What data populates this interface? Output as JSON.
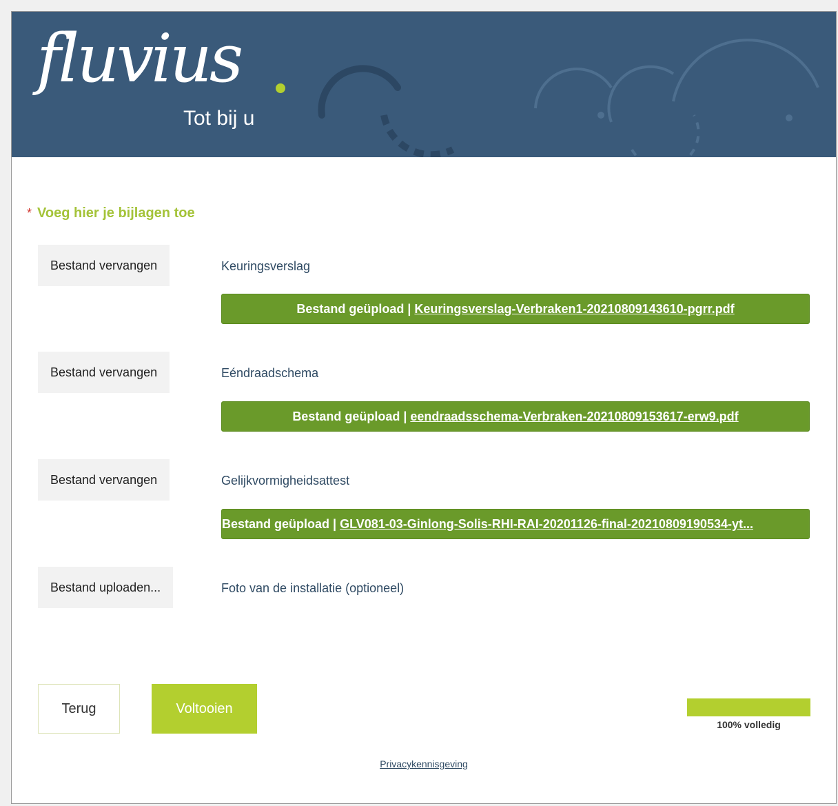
{
  "header": {
    "logo_text": "fluvius",
    "tagline": "Tot bij u"
  },
  "section": {
    "required_marker": "*",
    "title": "Voeg hier je bijlagen toe"
  },
  "attachments": [
    {
      "button_label": "Bestand vervangen",
      "label": "Keuringsverslag",
      "status_prefix": "Bestand geüpload | ",
      "file_name": "Keuringsverslag-Verbraken1-20210809143610-pgrr.pdf"
    },
    {
      "button_label": "Bestand vervangen",
      "label": "Eéndraadschema",
      "status_prefix": "Bestand geüpload | ",
      "file_name": "eendraadsschema-Verbraken-20210809153617-erw9.pdf"
    },
    {
      "button_label": "Bestand vervangen",
      "label": "Gelijkvormigheidsattest",
      "status_prefix": "Bestand geüpload | ",
      "file_name": "GLV081-03-Ginlong-Solis-RHI-RAI-20201126-final-20210809190534-yt..."
    },
    {
      "button_label": "Bestand uploaden...",
      "label": "Foto van de installatie (optioneel)"
    }
  ],
  "footer": {
    "back_label": "Terug",
    "finish_label": "Voltooien",
    "progress_percent": 100,
    "progress_text": "100% volledig",
    "privacy_link": "Privacykennisgeving"
  },
  "colors": {
    "header_bg": "#3a5a7a",
    "accent_green": "#b3cf2f",
    "upload_bar_green": "#6a9a2a",
    "required_red": "#d0342c"
  }
}
